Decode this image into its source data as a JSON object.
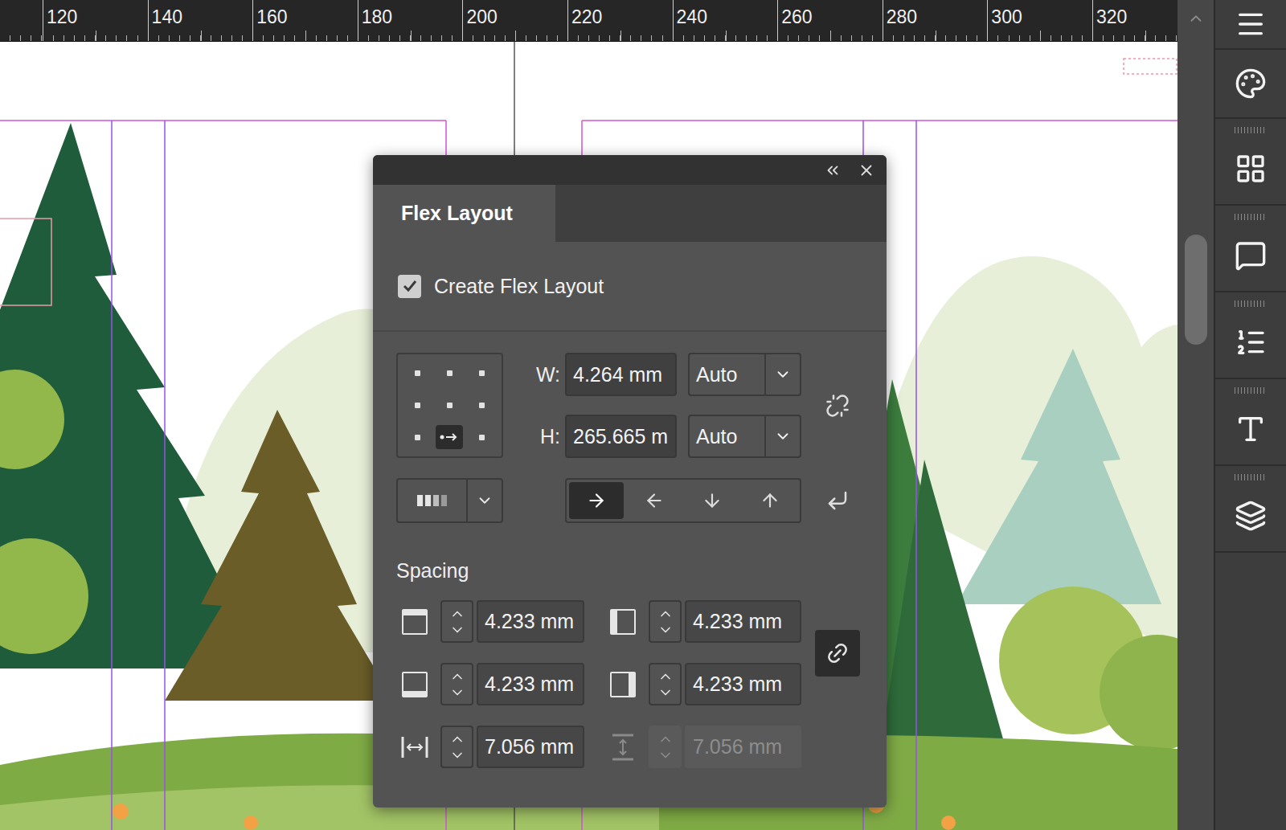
{
  "ruler": {
    "labels": [
      "120",
      "140",
      "160",
      "180",
      "200",
      "220",
      "240",
      "260",
      "280",
      "300",
      "320"
    ]
  },
  "flex_panel": {
    "tabs": [
      {
        "label": "Flex Layout",
        "selected": true
      }
    ],
    "create_flex_layout": {
      "label": "Create Flex Layout",
      "checked": true
    },
    "alignment_cells": [
      {
        "selected": false
      },
      {
        "selected": false
      },
      {
        "selected": false
      },
      {
        "selected": false
      },
      {
        "selected": false
      },
      {
        "selected": false
      },
      {
        "selected": false
      },
      {
        "selected": true
      },
      {
        "selected": false
      }
    ],
    "width": {
      "label": "W:",
      "value": "4.264 mm",
      "mode": "Auto"
    },
    "height": {
      "label": "H:",
      "value": "265.665 m",
      "mode": "Auto"
    },
    "size_linked": false,
    "directions": [
      {
        "kind": "right",
        "selected": true
      },
      {
        "kind": "left",
        "selected": false
      },
      {
        "kind": "down",
        "selected": false
      },
      {
        "kind": "up",
        "selected": false
      }
    ],
    "spacing": {
      "label": "Spacing",
      "linked": true,
      "fields": [
        {
          "kind": "top",
          "value": "4.233 mm",
          "disabled": false
        },
        {
          "kind": "left",
          "value": "4.233 mm",
          "disabled": false
        },
        {
          "kind": "bottom",
          "value": "4.233 mm",
          "disabled": false
        },
        {
          "kind": "right",
          "value": "4.233 mm",
          "disabled": false
        },
        {
          "kind": "column-gap",
          "value": "7.056 mm",
          "disabled": false
        },
        {
          "kind": "row-gap",
          "value": "7.056 mm",
          "disabled": true
        }
      ]
    }
  }
}
